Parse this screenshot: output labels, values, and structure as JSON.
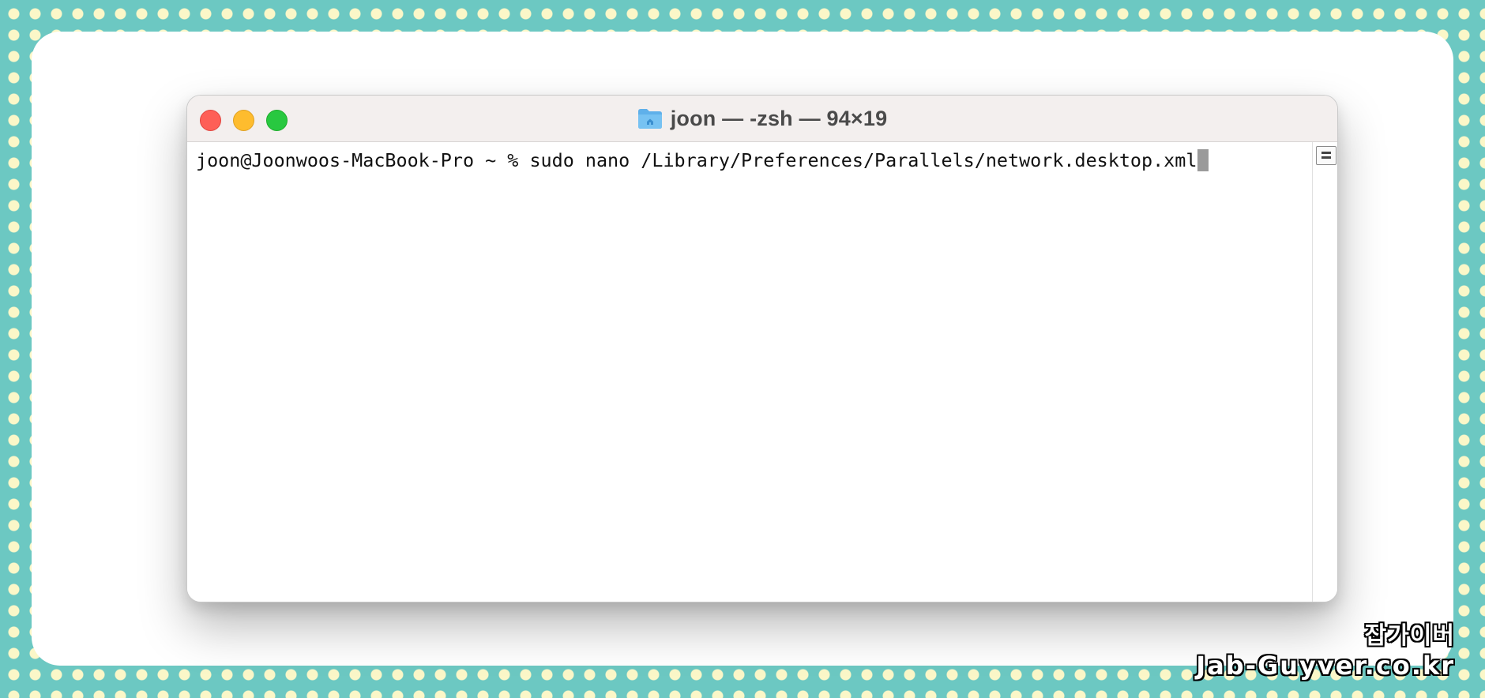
{
  "window": {
    "title": "joon — -zsh — 94×19",
    "traffic_lights": [
      "close",
      "minimize",
      "maximize"
    ],
    "folder_icon": "home-folder-icon"
  },
  "terminal": {
    "prompt_line": "joon@Joonwoos-MacBook-Pro ~ % sudo nano /Library/Preferences/Parallels/network.desktop.xml"
  },
  "watermark": {
    "korean": "잡가이버",
    "site": "Jab-Guyver.co.kr"
  },
  "colors": {
    "background_teal": "#6cc8c2",
    "dot": "#fbf7c8",
    "close": "#fe5f57",
    "minimize": "#febc2e",
    "maximize": "#28c840"
  }
}
